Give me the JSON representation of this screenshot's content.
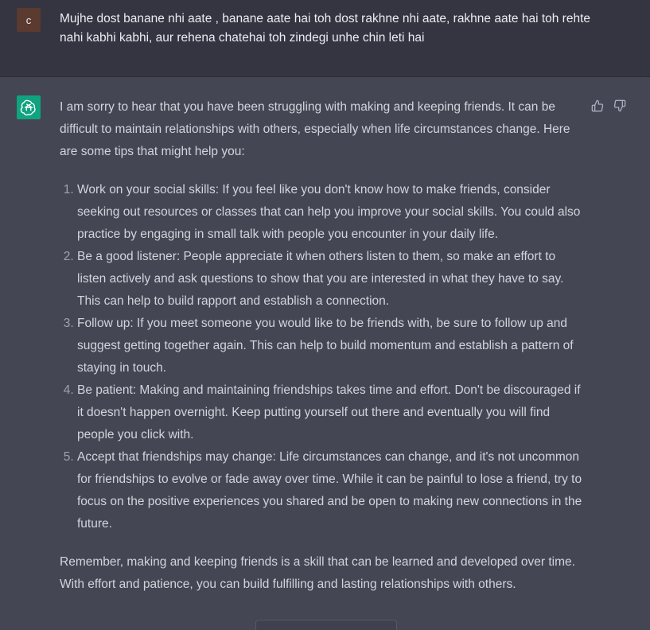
{
  "user": {
    "avatar_letter": "c",
    "message": "Mujhe dost banane nhi aate , banane aate hai toh dost rakhne nhi aate, rakhne aate hai toh rehte nahi kabhi kabhi, aur  rehena chatehai toh zindegi unhe chin leti hai"
  },
  "assistant": {
    "intro": "I am sorry to hear that you have been struggling with making and keeping friends. It can be difficult to maintain relationships with others, especially when life circumstances change. Here are some tips that might help you:",
    "tips": [
      "Work on your social skills: If you feel like you don't know how to make friends, consider seeking out resources or classes that can help you improve your social skills. You could also practice by engaging in small talk with people you encounter in your daily life.",
      "Be a good listener: People appreciate it when others listen to them, so make an effort to listen actively and ask questions to show that you are interested in what they have to say. This can help to build rapport and establish a connection.",
      "Follow up: If you meet someone you would like to be friends with, be sure to follow up and suggest getting together again. This can help to build momentum and establish a pattern of staying in touch.",
      "Be patient: Making and maintaining friendships takes time and effort. Don't be discouraged if it doesn't happen overnight. Keep putting yourself out there and eventually you will find people you click with.",
      "Accept that friendships may change: Life circumstances can change, and it's not uncommon for friendships to evolve or fade away over time. While it can be painful to lose a friend, try to focus on the positive experiences you shared and be open to making new connections in the future."
    ],
    "closing": "Remember, making and keeping friends is a skill that can be learned and developed over time. With effort and patience, you can build fulfilling and lasting relationships with others."
  },
  "icons": {
    "assistant_avatar": "openai-logo-icon",
    "feedback_up": "thumbs-up-icon",
    "feedback_down": "thumbs-down-icon"
  },
  "colors": {
    "user_bg": "#343541",
    "assistant_bg": "#444654",
    "gpt_avatar": "#10a37f",
    "user_avatar": "#5b3a2f"
  }
}
